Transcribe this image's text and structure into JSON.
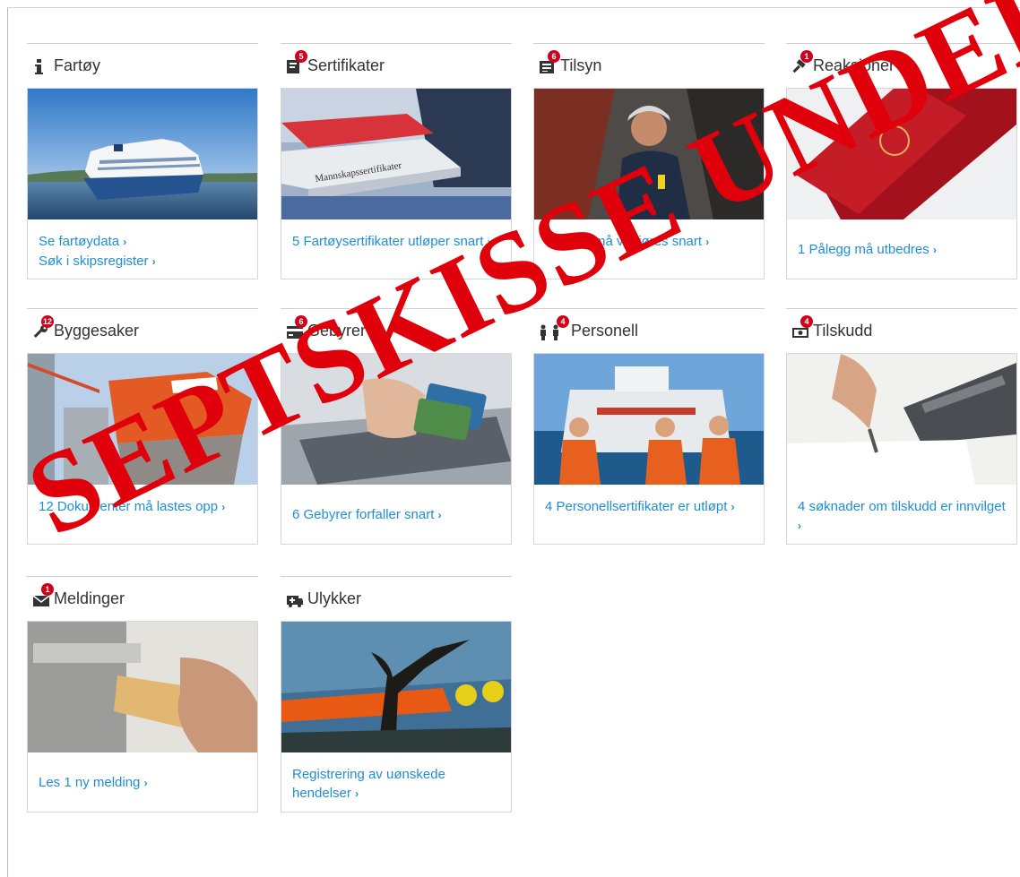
{
  "tiles": [
    {
      "title": "Fartøy",
      "icon": "info-icon",
      "badge": "",
      "links": [
        "Se fartøydata",
        "Søk i skipsregister"
      ]
    },
    {
      "title": "Sertifikater",
      "icon": "certificate-icon",
      "badge": "5",
      "links": [
        "5 Fartøysertifikater utløper snart"
      ]
    },
    {
      "title": "Tilsyn",
      "icon": "inspection-icon",
      "badge": "6",
      "links": [
        "6 Tilsyn må vegjøres snart"
      ]
    },
    {
      "title": "Reaksjoner",
      "icon": "gavel-icon",
      "badge": "1",
      "links": [
        "1 Pålegg må utbedres"
      ]
    },
    {
      "title": "Byggesaker",
      "icon": "wrench-icon",
      "badge": "12",
      "links": [
        "12 Dokumenter må lastes opp"
      ]
    },
    {
      "title": "Gebyrer",
      "icon": "credit-card-icon",
      "badge": "6",
      "links": [
        "6 Gebyrer forfaller snart"
      ]
    },
    {
      "title": "Personell",
      "icon": "people-icon",
      "badge": "4",
      "links": [
        "4 Personellsertifikater er utløpt"
      ]
    },
    {
      "title": "Tilskudd",
      "icon": "money-icon",
      "badge": "4",
      "links": [
        "4 søknader om tilskudd er innvilget"
      ]
    },
    {
      "title": "Meldinger",
      "icon": "envelope-icon",
      "badge": "1",
      "links": [
        "Les 1 ny melding"
      ]
    },
    {
      "title": "Ulykker",
      "icon": "ambulance-icon",
      "badge": "",
      "links": [
        "Registrering av uønskede hendelser"
      ]
    }
  ],
  "image_text": {
    "certificate_book": "Mannskapssertifikater"
  },
  "stamp_text": "SEPTSKISSE UNDER U",
  "colors": {
    "link": "#1e8ed6",
    "badge": "#d0021b",
    "stamp": "#e0000b"
  }
}
